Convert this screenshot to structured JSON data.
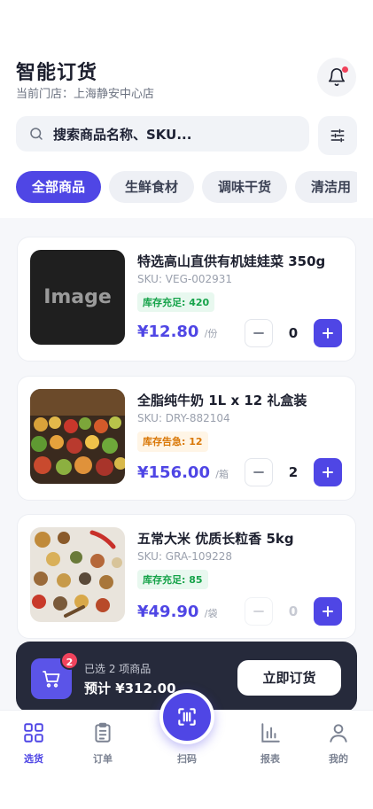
{
  "header": {
    "title": "智能订货",
    "store": "当前门店：上海静安中心店"
  },
  "search": {
    "text": "搜索商品名称、SKU..."
  },
  "categories": [
    "全部商品",
    "生鲜食材",
    "调味干货",
    "清洁用"
  ],
  "products": [
    {
      "name": "特选高山直供有机娃娃菜 350g",
      "sku": "SKU: VEG-002931",
      "stock": "库存充足: 420",
      "stock_status": "ok",
      "price": "¥12.80",
      "unit": "/份",
      "qty": "0",
      "image_label": "Image"
    },
    {
      "name": "全脂纯牛奶 1L x 12 礼盒装",
      "sku": "SKU: DRY-882104",
      "stock": "库存告急: 12",
      "stock_status": "warn",
      "price": "¥156.00",
      "unit": "/箱",
      "qty": "2"
    },
    {
      "name": "五常大米 优质长粒香 5kg",
      "sku": "SKU: GRA-109228",
      "stock": "库存充足: 85",
      "stock_status": "ok",
      "price": "¥49.90",
      "unit": "/袋",
      "qty": "0"
    }
  ],
  "cart": {
    "badge": "2",
    "selected": "已选 2 项商品",
    "total": "预计 ¥312.00",
    "order_label": "立即订货"
  },
  "tabs": [
    {
      "label": "选货",
      "icon": "grid-icon",
      "active": true
    },
    {
      "label": "订单",
      "icon": "clipboard-icon",
      "active": false
    },
    {
      "label": "扫码",
      "icon": "scan-icon",
      "active": false
    },
    {
      "label": "报表",
      "icon": "bar-chart-icon",
      "active": false
    },
    {
      "label": "我的",
      "icon": "user-icon",
      "active": false
    }
  ],
  "colors": {
    "accent": "#4f46e5",
    "dark": "#262a3b",
    "badge": "#f0435c"
  }
}
